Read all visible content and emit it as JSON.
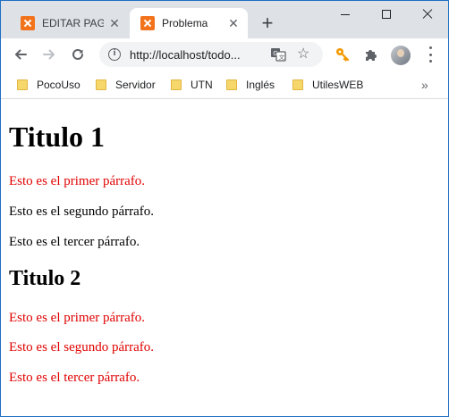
{
  "browser": {
    "tabs": [
      {
        "title": "EDITAR PAGINAS",
        "active": false
      },
      {
        "title": "Problema",
        "active": true
      }
    ],
    "url": "http://localhost/todo...",
    "bookmarks": [
      "PocoUso",
      "Servidor",
      "UTN",
      "Inglés",
      "UtilesWEB"
    ],
    "bookmarks_more": "»"
  },
  "page": {
    "heading1": "Titulo 1",
    "section1": [
      {
        "text": "Esto es el primer párrafo.",
        "color": "#e00000"
      },
      {
        "text": "Esto es el segundo párrafo.",
        "color": "#000000"
      },
      {
        "text": "Esto es el tercer párrafo.",
        "color": "#000000"
      }
    ],
    "heading2": "Titulo 2",
    "section2": [
      {
        "text": "Esto es el primer párrafo.",
        "color": "#e00000"
      },
      {
        "text": "Esto es el segundo párrafo.",
        "color": "#e00000"
      },
      {
        "text": "Esto es el tercer párrafo.",
        "color": "#e00000"
      }
    ]
  },
  "icons": {
    "favicon": "xampp-icon",
    "back": "arrow-left-icon",
    "forward": "arrow-right-icon",
    "reload": "reload-icon",
    "info": "info-icon",
    "translate": "translate-icon",
    "bookmark": "star-icon",
    "extension1": "key-icon",
    "extensions": "puzzle-icon",
    "profile": "avatar",
    "menu": "kebab-menu-icon",
    "folder": "folder-icon"
  }
}
